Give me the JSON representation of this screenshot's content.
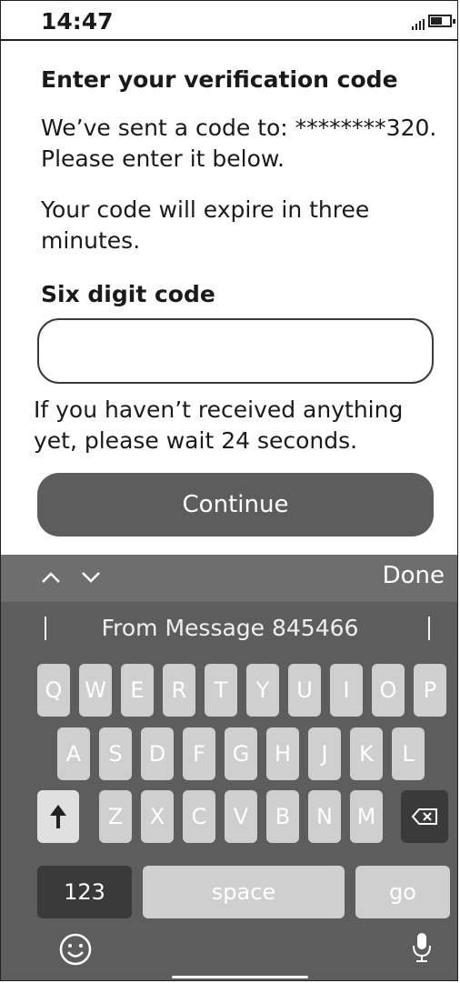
{
  "status_bar": {
    "time": "14:47"
  },
  "content": {
    "title": "Enter your verification code",
    "sent_line1": "We’ve sent a code to: ********320.",
    "sent_line2": "Please enter it below.",
    "expire_line1": "Your code will expire in three",
    "expire_line2": "minutes.",
    "code_label": "Six digit code",
    "code_value": "",
    "wait_line1": "If you haven’t received anything",
    "wait_line2": "yet, please wait 24 seconds.",
    "continue_label": "Continue"
  },
  "keyboard": {
    "done_label": "Done",
    "suggestion": "From Message 845466",
    "row1": [
      "Q",
      "W",
      "E",
      "R",
      "T",
      "Y",
      "U",
      "I",
      "O",
      "P"
    ],
    "row2": [
      "A",
      "S",
      "D",
      "F",
      "G",
      "H",
      "J",
      "K",
      "L"
    ],
    "row3": [
      "Z",
      "X",
      "C",
      "V",
      "B",
      "N",
      "M"
    ],
    "numbers_label": "123",
    "space_label": "space",
    "go_label": "go"
  },
  "icons": [
    "signal-icon",
    "battery-icon",
    "chevron-up-icon",
    "chevron-down-icon",
    "shift-icon",
    "backspace-icon",
    "emoji-icon",
    "microphone-icon"
  ]
}
